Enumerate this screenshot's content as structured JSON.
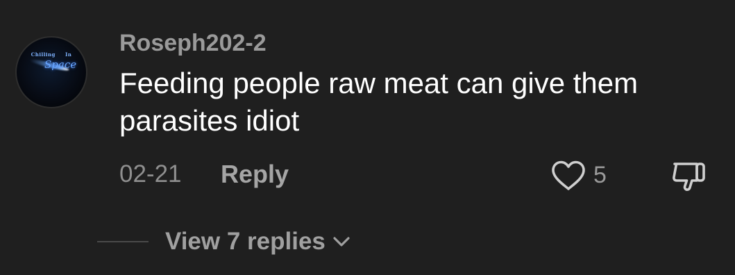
{
  "comment": {
    "avatar": {
      "line1_left": "Chilling",
      "line1_right": "In",
      "line2": "Space"
    },
    "username": "Roseph202-2",
    "text": "Feeding people raw meat can give them parasites idiot",
    "date": "02-21",
    "reply_label": "Reply",
    "like_count": "5",
    "view_replies_label": "View 7 replies"
  },
  "icons": {
    "like": "heart-outline-icon",
    "dislike": "thumbs-down-outline-icon",
    "expand": "chevron-down-icon"
  },
  "colors": {
    "background": "#1f1f1f",
    "text_primary": "#ffffff",
    "text_secondary": "#9a9a9a"
  }
}
